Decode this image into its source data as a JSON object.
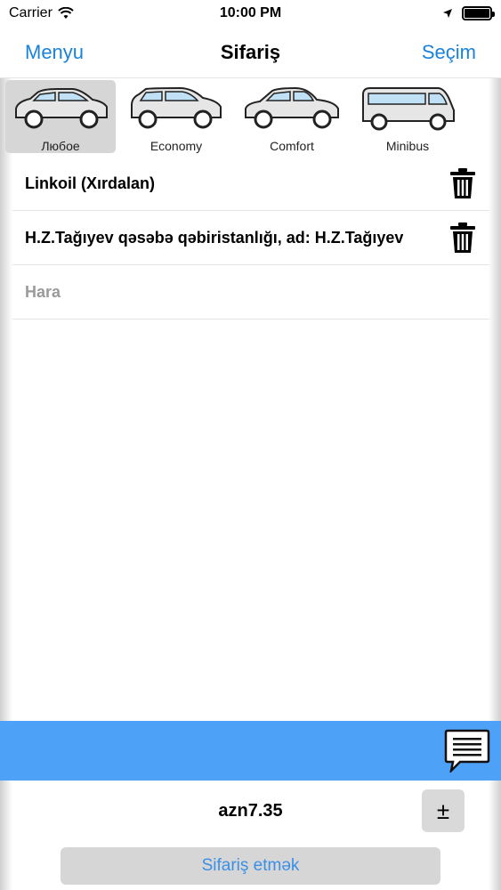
{
  "status_bar": {
    "carrier": "Carrier",
    "time": "10:00 PM",
    "battery_level": 1.0
  },
  "nav": {
    "left_button": "Menyu",
    "title": "Sifariş",
    "right_button": "Seçim"
  },
  "car_types": [
    {
      "label": "Любое",
      "icon": "hatchback-car-icon",
      "selected": true
    },
    {
      "label": "Economy",
      "icon": "hatchback-car-icon",
      "selected": false
    },
    {
      "label": "Comfort",
      "icon": "sedan-car-icon",
      "selected": false
    },
    {
      "label": "Minibus",
      "icon": "minibus-icon",
      "selected": false
    }
  ],
  "route": {
    "stops": [
      {
        "text": "Linkoil (Xırdalan)",
        "icon": "trash-icon"
      },
      {
        "text": "H.Z.Tağıyev qəsəbə qəbiristanlığı, ad: H.Z.Tağıyev",
        "icon": "trash-icon"
      }
    ],
    "destination_placeholder": "Hara"
  },
  "chat_icon": "chat-bubble-icon",
  "price": "azn7.35",
  "adjust_button": "±",
  "order_button": "Sifariş etmək",
  "colors": {
    "accent": "#1a82d9",
    "band": "#4da1f7",
    "selected_bg": "#d6d6d6"
  }
}
